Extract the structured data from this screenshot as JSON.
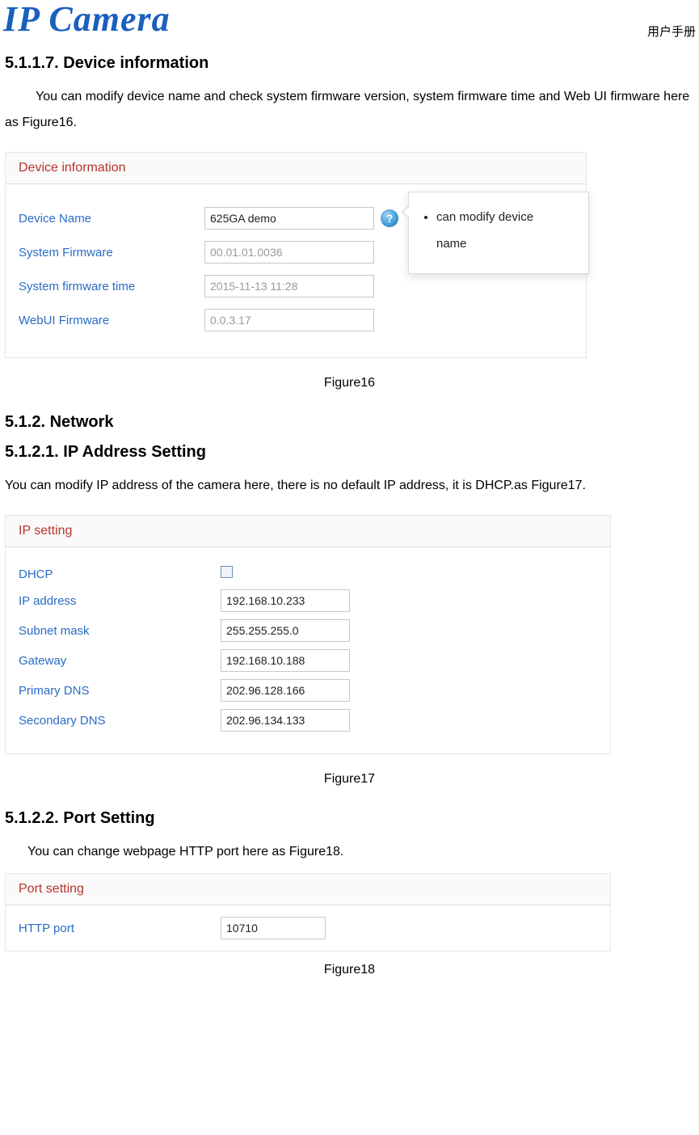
{
  "header": {
    "logo_text": "IP Camera",
    "manual_label": "用户手册"
  },
  "sections": {
    "s51117_title": "5.1.1.7. Device information",
    "s51117_para": "You can modify device name and check system firmware version, system firmware time and Web UI firmware here as Figure16.",
    "fig16_caption": "Figure16",
    "s512_title": "5.1.2.  Network",
    "s51211_title": "5.1.2.1. IP Address Setting",
    "s51211_para": "You can modify IP address of the camera here, there is no default IP address, it is DHCP.as Figure17.",
    "fig17_caption": "Figure17",
    "s51222_title": "5.1.2.2. Port Setting",
    "s51222_para": "You can change webpage HTTP port here as Figure18.",
    "fig18_caption": "Figure18"
  },
  "device_info_panel": {
    "title": "Device information",
    "rows": {
      "device_name_label": "Device Name",
      "device_name_value": "625GA demo",
      "system_firmware_label": "System Firmware",
      "system_firmware_value": "00.01.01.0036",
      "system_firmware_time_label": "System firmware time",
      "system_firmware_time_value": "2015-11-13 11:28",
      "webui_firmware_label": "WebUI Firmware",
      "webui_firmware_value": "0.0.3.17"
    },
    "tooltip_line1": "can modify device",
    "tooltip_line2": "name"
  },
  "ip_setting_panel": {
    "title": "IP setting",
    "rows": {
      "dhcp_label": "DHCP",
      "dhcp_checked": false,
      "ip_label": "IP address",
      "ip_value": "192.168.10.233",
      "subnet_label": "Subnet mask",
      "subnet_value": "255.255.255.0",
      "gateway_label": "Gateway",
      "gateway_value": "192.168.10.188",
      "pdns_label": "Primary DNS",
      "pdns_value": "202.96.128.166",
      "sdns_label": "Secondary DNS",
      "sdns_value": "202.96.134.133"
    }
  },
  "port_setting_panel": {
    "title": "Port setting",
    "rows": {
      "http_label": "HTTP port",
      "http_value": "10710"
    }
  }
}
